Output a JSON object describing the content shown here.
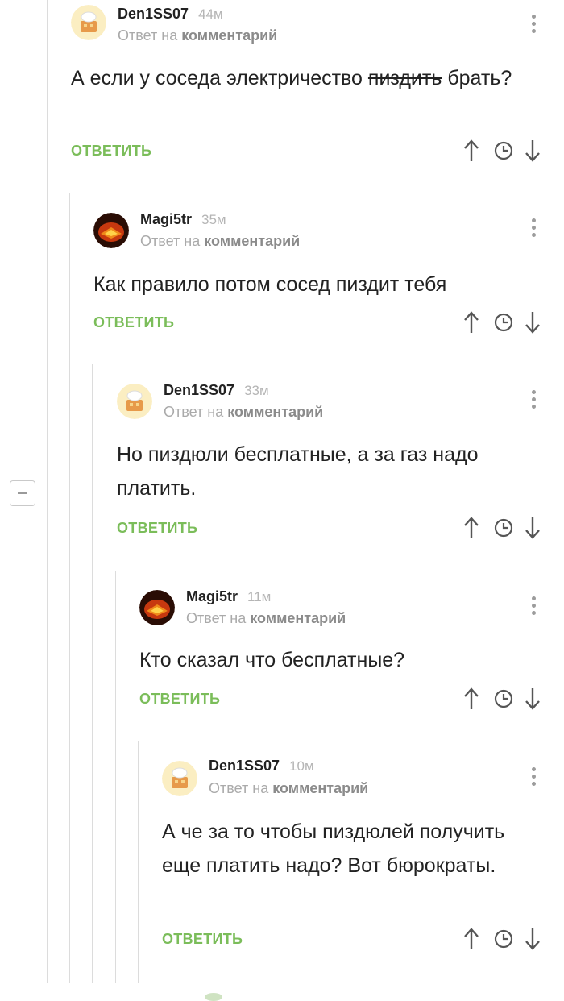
{
  "comments": [
    {
      "author": "Den1SS07",
      "time": "44м",
      "reply_prefix": "Ответ на",
      "reply_target": "комментарий",
      "text_before": "А если у соседа электричество ",
      "text_strike": "пиздить",
      "text_after": " брать?",
      "reply_label": "ОТВЕТИТЬ",
      "avatar": "chef-hat-avatar"
    },
    {
      "author": "Magi5tr",
      "time": "35м",
      "reply_prefix": "Ответ на",
      "reply_target": "комментарий",
      "text": "Как правило потом сосед пиздит тебя",
      "reply_label": "ОТВЕТИТЬ",
      "avatar": "fire-book-avatar"
    },
    {
      "author": "Den1SS07",
      "time": "33м",
      "reply_prefix": "Ответ на",
      "reply_target": "комментарий",
      "text": "Но пиздюли бесплатные, а за газ надо платить.",
      "reply_label": "ОТВЕТИТЬ",
      "avatar": "chef-hat-avatar"
    },
    {
      "author": "Magi5tr",
      "time": "11м",
      "reply_prefix": "Ответ на",
      "reply_target": "комментарий",
      "text": "Кто сказал что бесплатные?",
      "reply_label": "ОТВЕТИТЬ",
      "avatar": "fire-book-avatar"
    },
    {
      "author": "Den1SS07",
      "time": "10м",
      "reply_prefix": "Ответ на",
      "reply_target": "комментарий",
      "text": "А че за то чтобы пиздюлей получить еще платить надо? Вот бюрократы.",
      "reply_label": "ОТВЕТИТЬ",
      "avatar": "chef-hat-avatar"
    }
  ],
  "icons": {
    "up": "arrow-up-icon",
    "clock": "clock-icon",
    "down": "arrow-down-icon",
    "menu": "more-vertical-icon",
    "collapse": "minus-icon"
  },
  "colors": {
    "reply_green": "#7bbd5a",
    "meta_gray": "#aaaaaa",
    "line_gray": "#dcdcdc"
  }
}
